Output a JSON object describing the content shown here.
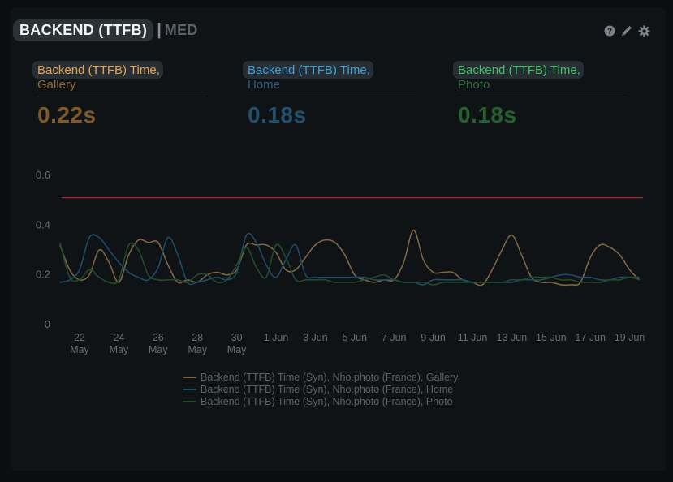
{
  "header": {
    "title": "BACKEND (TTFB)",
    "separator": "|",
    "subtitle": "MED"
  },
  "icons": [
    "help-icon",
    "pencil-icon",
    "gear-icon"
  ],
  "stats": [
    {
      "label": "Backend (TTFB) Time,",
      "sub": "Gallery",
      "value": "0.22s",
      "color": "#e8a34f",
      "sub_color": "#8d6a3c",
      "value_color": "#7d5a2c"
    },
    {
      "label": "Backend (TTFB) Time,",
      "sub": "Home",
      "value": "0.18s",
      "color": "#3fa0d8",
      "sub_color": "#2c5d7a",
      "value_color": "#20506c"
    },
    {
      "label": "Backend (TTFB) Time,",
      "sub": "Photo",
      "value": "0.18s",
      "color": "#3fbf62",
      "sub_color": "#2f6a3d",
      "value_color": "#25602f"
    }
  ],
  "chart_data": {
    "type": "line",
    "ylim": [
      0,
      0.6
    ],
    "yticks": [
      "0.6",
      "0.4",
      "0.2",
      "0"
    ],
    "ytick_values": [
      0.6,
      0.4,
      0.2,
      0
    ],
    "x_start": "2023-05-21",
    "xticks": [
      {
        "day": 1,
        "line1": "22",
        "line2": "May"
      },
      {
        "day": 3,
        "line1": "24",
        "line2": "May"
      },
      {
        "day": 5,
        "line1": "26",
        "line2": "May"
      },
      {
        "day": 7,
        "line1": "28",
        "line2": "May"
      },
      {
        "day": 9,
        "line1": "30",
        "line2": "May"
      },
      {
        "day": 11,
        "line1": "1 Jun",
        "line2": ""
      },
      {
        "day": 13,
        "line1": "3 Jun",
        "line2": ""
      },
      {
        "day": 15,
        "line1": "5 Jun",
        "line2": ""
      },
      {
        "day": 17,
        "line1": "7 Jun",
        "line2": ""
      },
      {
        "day": 19,
        "line1": "9 Jun",
        "line2": ""
      },
      {
        "day": 21,
        "line1": "11 Jun",
        "line2": ""
      },
      {
        "day": 23,
        "line1": "13 Jun",
        "line2": ""
      },
      {
        "day": 25,
        "line1": "15 Jun",
        "line2": ""
      },
      {
        "day": 27,
        "line1": "17 Jun",
        "line2": ""
      },
      {
        "day": 29,
        "line1": "19 Jun",
        "line2": ""
      }
    ],
    "threshold": {
      "value": 0.51,
      "color": "#b02a25"
    },
    "series": [
      {
        "name": "Backend (TTFB) Time (Syn), Nho.photo (France), Gallery",
        "color": "#7d6444",
        "x": [
          0,
          0.5,
          1,
          1.5,
          2,
          2.5,
          3,
          3.5,
          4,
          4.5,
          5,
          5.5,
          6,
          6.5,
          7,
          7.5,
          8,
          8.5,
          9,
          9.5,
          10,
          10.5,
          11,
          11.5,
          12,
          12.5,
          13,
          13.5,
          14,
          14.5,
          15,
          15.5,
          16,
          16.5,
          17,
          17.5,
          18,
          18.5,
          19,
          19.5,
          20,
          20.5,
          21,
          21.5,
          22,
          22.5,
          23,
          23.5,
          24,
          24.5,
          25,
          25.5,
          26,
          26.5,
          27,
          27.5,
          28,
          28.5,
          29,
          29.5
        ],
        "y": [
          0.32,
          0.22,
          0.18,
          0.2,
          0.3,
          0.25,
          0.17,
          0.28,
          0.34,
          0.33,
          0.33,
          0.24,
          0.17,
          0.18,
          0.17,
          0.2,
          0.21,
          0.2,
          0.22,
          0.32,
          0.32,
          0.32,
          0.29,
          0.22,
          0.22,
          0.27,
          0.32,
          0.34,
          0.33,
          0.28,
          0.2,
          0.18,
          0.17,
          0.18,
          0.18,
          0.25,
          0.38,
          0.26,
          0.21,
          0.21,
          0.21,
          0.18,
          0.17,
          0.16,
          0.22,
          0.3,
          0.36,
          0.28,
          0.19,
          0.17,
          0.17,
          0.16,
          0.16,
          0.17,
          0.27,
          0.32,
          0.31,
          0.28,
          0.22,
          0.18
        ]
      },
      {
        "name": "Backend (TTFB) Time (Syn), Nho.photo (France), Home",
        "color": "#1f4a66",
        "x": [
          0,
          0.5,
          1,
          1.5,
          2,
          2.5,
          3,
          3.5,
          4,
          4.5,
          5,
          5.5,
          6,
          6.5,
          7,
          7.5,
          8,
          8.5,
          9,
          9.5,
          10,
          10.5,
          11,
          11.5,
          12,
          12.5,
          13,
          13.5,
          14,
          14.5,
          15,
          15.5,
          16,
          16.5,
          17,
          17.5,
          18,
          18.5,
          19,
          19.5,
          20,
          20.5,
          21,
          21.5,
          22,
          22.5,
          23,
          23.5,
          24,
          24.5,
          25,
          25.5,
          26,
          26.5,
          27,
          27.5,
          28,
          28.5,
          29,
          29.5
        ],
        "y": [
          0.17,
          0.18,
          0.22,
          0.35,
          0.35,
          0.3,
          0.25,
          0.21,
          0.19,
          0.18,
          0.23,
          0.35,
          0.28,
          0.17,
          0.17,
          0.18,
          0.19,
          0.18,
          0.21,
          0.36,
          0.33,
          0.24,
          0.19,
          0.26,
          0.32,
          0.2,
          0.19,
          0.19,
          0.19,
          0.19,
          0.19,
          0.19,
          0.18,
          0.18,
          0.18,
          0.17,
          0.17,
          0.16,
          0.18,
          0.18,
          0.18,
          0.18,
          0.17,
          0.17,
          0.17,
          0.17,
          0.17,
          0.18,
          0.18,
          0.18,
          0.19,
          0.2,
          0.2,
          0.19,
          0.19,
          0.18,
          0.18,
          0.19,
          0.19,
          0.19
        ]
      },
      {
        "name": "Backend (TTFB) Time (Syn), Nho.photo (France), Photo",
        "color": "#234a2b",
        "x": [
          0,
          0.5,
          1,
          1.5,
          2,
          2.5,
          3,
          3.5,
          4,
          4.5,
          5,
          5.5,
          6,
          6.5,
          7,
          7.5,
          8,
          8.5,
          9,
          9.5,
          10,
          10.5,
          11,
          11.5,
          12,
          12.5,
          13,
          13.5,
          14,
          14.5,
          15,
          15.5,
          16,
          16.5,
          17,
          17.5,
          18,
          18.5,
          19,
          19.5,
          20,
          20.5,
          21,
          21.5,
          22,
          22.5,
          23,
          23.5,
          24,
          24.5,
          25,
          25.5,
          26,
          26.5,
          27,
          27.5,
          28,
          28.5,
          29,
          29.5
        ],
        "y": [
          0.33,
          0.19,
          0.18,
          0.22,
          0.19,
          0.17,
          0.18,
          0.32,
          0.3,
          0.2,
          0.18,
          0.18,
          0.18,
          0.17,
          0.2,
          0.2,
          0.17,
          0.18,
          0.24,
          0.31,
          0.23,
          0.19,
          0.32,
          0.27,
          0.18,
          0.18,
          0.18,
          0.18,
          0.17,
          0.17,
          0.17,
          0.18,
          0.19,
          0.2,
          0.18,
          0.17,
          0.17,
          0.17,
          0.16,
          0.17,
          0.17,
          0.17,
          0.17,
          0.17,
          0.17,
          0.17,
          0.18,
          0.18,
          0.19,
          0.19,
          0.19,
          0.18,
          0.18,
          0.17,
          0.17,
          0.17,
          0.18,
          0.18,
          0.19,
          0.18
        ]
      }
    ]
  }
}
